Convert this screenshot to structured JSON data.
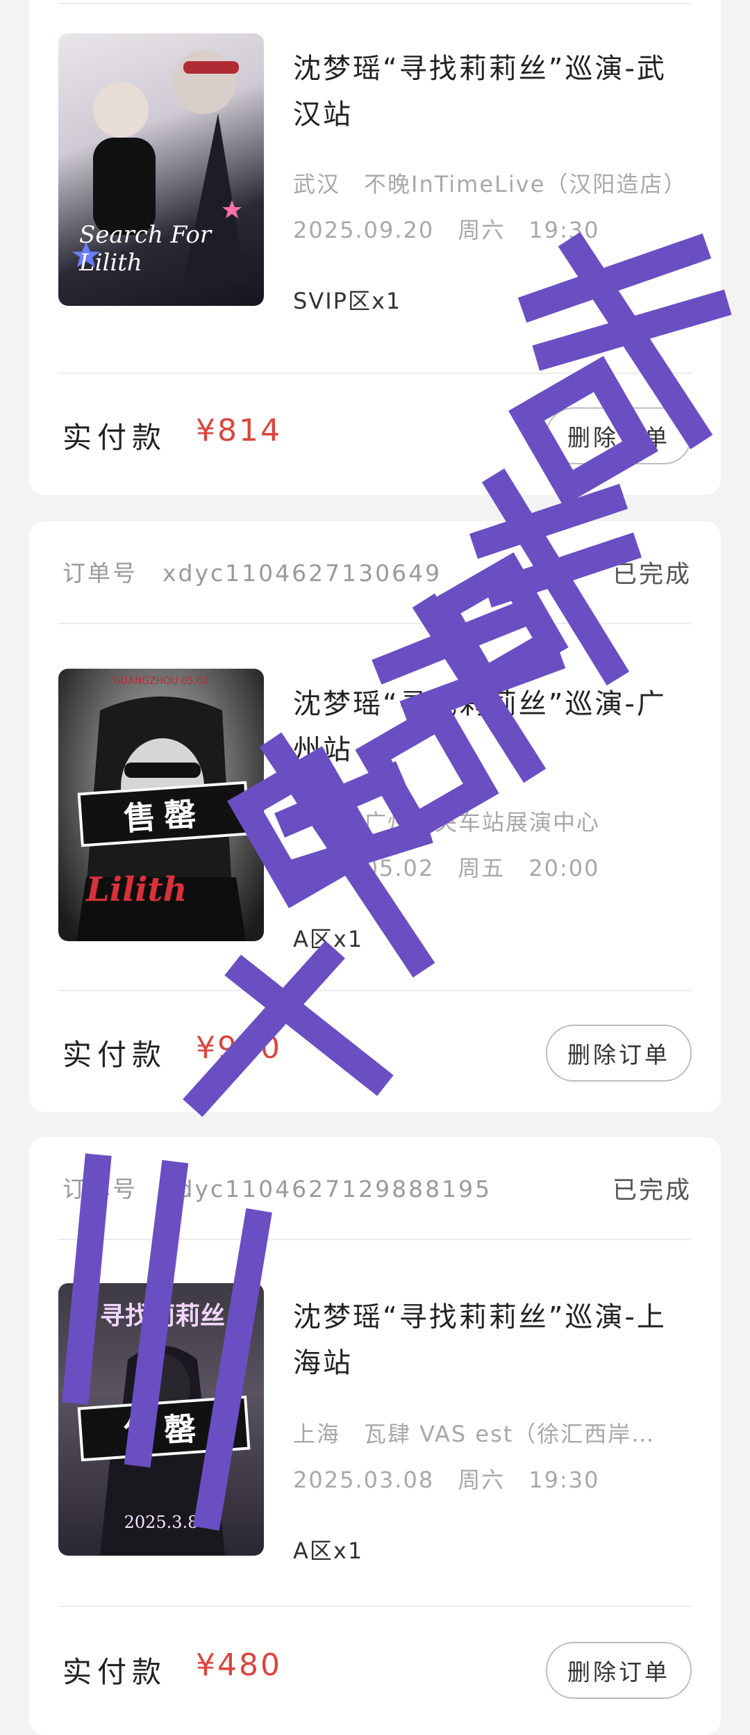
{
  "orders": [
    {
      "order_number": "",
      "status": "",
      "title": "沈梦瑶“寻找莉莉丝”巡演-武汉站",
      "venue": "武汉　不晚InTimeLive（汉阳造店）",
      "date": "2025.09.20　周六　19:30",
      "ticket": "SVIP区x1",
      "pay_label": "实付款",
      "pay_amount": "¥814",
      "delete_label": "删除订单",
      "poster_text": "Search For Lilith",
      "stamp": ""
    },
    {
      "order_number": "订单号　xdyc1104627130649",
      "status": "已完成",
      "title": "沈梦瑶“寻找莉莉丝”巡演-广州站",
      "venue": "广州　广州中央车站展演中心",
      "date": "2025.05.02　周五　20:00",
      "ticket": "A区x1",
      "pay_label": "实付款",
      "pay_amount": "¥960",
      "delete_label": "删除订单",
      "poster_text": "Lilith",
      "poster_header": "GUANGZHOU 05.02",
      "stamp": "售罄"
    },
    {
      "order_number": "订单号　xdyc1104627129888195",
      "status": "已完成",
      "title": "沈梦瑶“寻找莉莉丝”巡演-上海站",
      "venue": "上海　瓦肆 VAS est（徐汇西岸…",
      "date": "2025.03.08　周六　19:30",
      "ticket": "A区x1",
      "pay_label": "实付款",
      "pay_amount": "¥480",
      "delete_label": "删除订单",
      "poster_text": "寻找莉莉丝",
      "poster_date": "2025.3.8",
      "stamp": "售罄"
    }
  ],
  "watermark": {
    "text": "三人售罄",
    "color": "#6a4fc3"
  }
}
